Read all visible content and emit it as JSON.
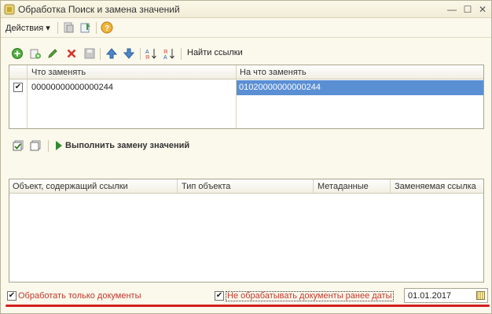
{
  "window": {
    "title": "Обработка  Поиск и замена значений",
    "minimize_glyph": "—",
    "maximize_glyph": "☐",
    "close_glyph": "✕"
  },
  "menu": {
    "actions_label": "Действия ▾",
    "help_glyph": "?"
  },
  "toolbar": {
    "find_links_label": "Найти ссылки",
    "icons": [
      "add-icon",
      "copy-icon",
      "edit-icon",
      "delete-icon",
      "save-icon",
      "move-up-icon",
      "move-down-icon",
      "sort-ascending-icon",
      "sort-descending-icon"
    ]
  },
  "replace_table": {
    "columns": [
      "Что заменять",
      "На что заменять"
    ],
    "rows": [
      {
        "checked": true,
        "what": "00000000000000244",
        "to": "01020000000000244"
      }
    ]
  },
  "execute": {
    "label": "Выполнить замену значений"
  },
  "links_table": {
    "columns": [
      "Объект, содержащий ссылки",
      "Тип объекта",
      "Метаданные",
      "Заменяемая ссылка"
    ]
  },
  "bottom": {
    "only_documents_label": "Обработать только документы",
    "only_documents_checked": true,
    "skip_before_date_label": "Не обрабатывать документы ранее даты",
    "skip_before_date_checked": true,
    "date_value": "01.01.2017"
  },
  "colors": {
    "window_bg": "#fbf8ec",
    "selection": "#5b8fd4",
    "highlight_red": "#d21f1f",
    "label_red": "#c0392b"
  }
}
